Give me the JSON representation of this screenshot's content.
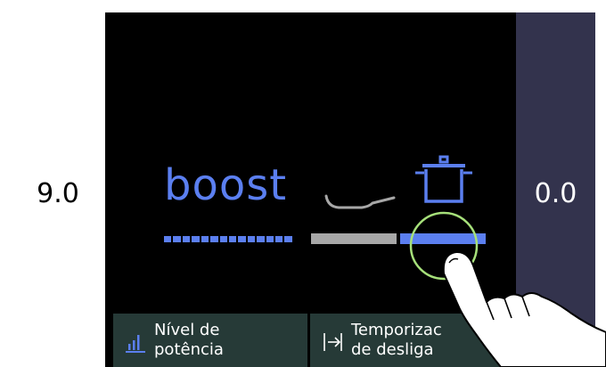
{
  "zones": {
    "left": {
      "value": "9.0"
    },
    "right": {
      "value": "0.0"
    }
  },
  "center": {
    "mode_label": "boost",
    "level_segments": 14,
    "pan_icon": "frying-pan-icon",
    "pot_icon": "cooking-pot-icon"
  },
  "zone_selector": {
    "segments": [
      {
        "name": "pan-zone-segment",
        "color": "#a7a7a7",
        "active": false
      },
      {
        "name": "pot-zone-segment",
        "color": "#5b7ff0",
        "active": true
      }
    ]
  },
  "buttons": {
    "power": {
      "icon": "power-level-bars-icon",
      "line1": "Nível de",
      "line2": "potência"
    },
    "timer": {
      "icon": "timer-off-arrow-icon",
      "line1": "Temporizac",
      "line2": "de desliga"
    }
  },
  "colors": {
    "accent": "#5b7ff0",
    "touch_ring": "#a6e07a",
    "button_bg": "#263a37",
    "right_panel_bg": "#33334d"
  },
  "overlay": {
    "icon": "pointing-hand-icon"
  }
}
